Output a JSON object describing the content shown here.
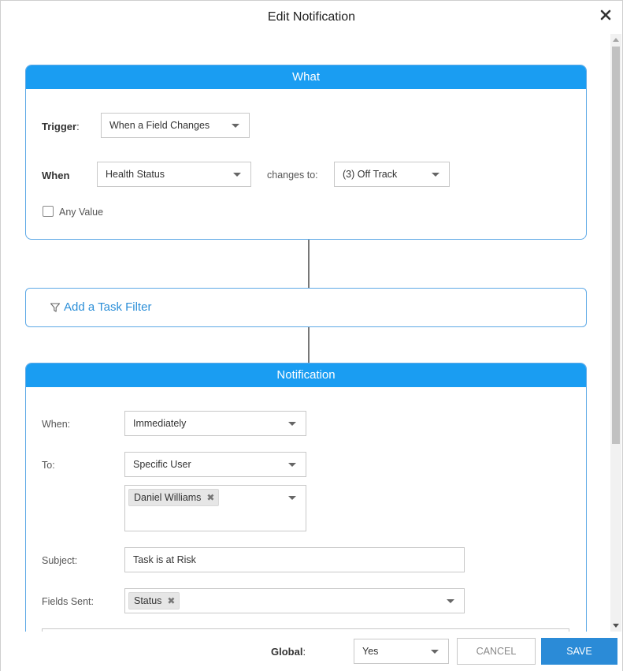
{
  "dialog": {
    "title": "Edit Notification"
  },
  "what": {
    "header": "What",
    "trigger_label": "Trigger",
    "trigger_colon": ":",
    "trigger_value": "When a Field Changes",
    "when_label": "When",
    "when_value": "Health Status",
    "changes_to_label": "changes to:",
    "changes_to_value": "(3) Off Track",
    "any_value_label": "Any Value",
    "any_value_checked": false
  },
  "filter": {
    "label": "Add a Task Filter"
  },
  "notification": {
    "header": "Notification",
    "when_label": "When:",
    "when_value": "Immediately",
    "to_label": "To:",
    "to_value": "Specific User",
    "recipients": [
      "Daniel Williams"
    ],
    "subject_label": "Subject:",
    "subject_value": "Task is at Risk",
    "fields_sent_label": "Fields Sent:",
    "fields_sent": [
      "Status"
    ]
  },
  "footer": {
    "global_label": "Global",
    "global_colon": ":",
    "global_value": "Yes",
    "cancel_label": "CANCEL",
    "save_label": "SAVE"
  },
  "colors": {
    "accent": "#1a9df2",
    "link": "#2c8fd8",
    "save": "#2b8bd7"
  }
}
